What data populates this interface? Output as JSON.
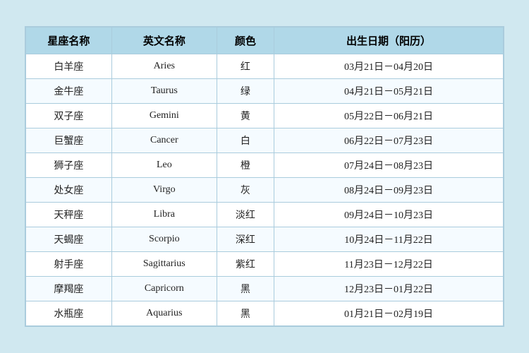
{
  "table": {
    "headers": [
      "星座名称",
      "英文名称",
      "颜色",
      "出生日期（阳历）"
    ],
    "rows": [
      {
        "zh": "白羊座",
        "en": "Aries",
        "color": "红",
        "date": "03月21日－04月20日"
      },
      {
        "zh": "金牛座",
        "en": "Taurus",
        "color": "绿",
        "date": "04月21日－05月21日"
      },
      {
        "zh": "双子座",
        "en": "Gemini",
        "color": "黄",
        "date": "05月22日－06月21日"
      },
      {
        "zh": "巨蟹座",
        "en": "Cancer",
        "color": "白",
        "date": "06月22日－07月23日"
      },
      {
        "zh": "狮子座",
        "en": "Leo",
        "color": "橙",
        "date": "07月24日－08月23日"
      },
      {
        "zh": "处女座",
        "en": "Virgo",
        "color": "灰",
        "date": "08月24日－09月23日"
      },
      {
        "zh": "天秤座",
        "en": "Libra",
        "color": "淡红",
        "date": "09月24日－10月23日"
      },
      {
        "zh": "天蝎座",
        "en": "Scorpio",
        "color": "深红",
        "date": "10月24日－11月22日"
      },
      {
        "zh": "射手座",
        "en": "Sagittarius",
        "color": "紫红",
        "date": "11月23日－12月22日"
      },
      {
        "zh": "摩羯座",
        "en": "Capricorn",
        "color": "黑",
        "date": "12月23日－01月22日"
      },
      {
        "zh": "水瓶座",
        "en": "Aquarius",
        "color": "黑",
        "date": "01月21日－02月19日"
      }
    ]
  }
}
